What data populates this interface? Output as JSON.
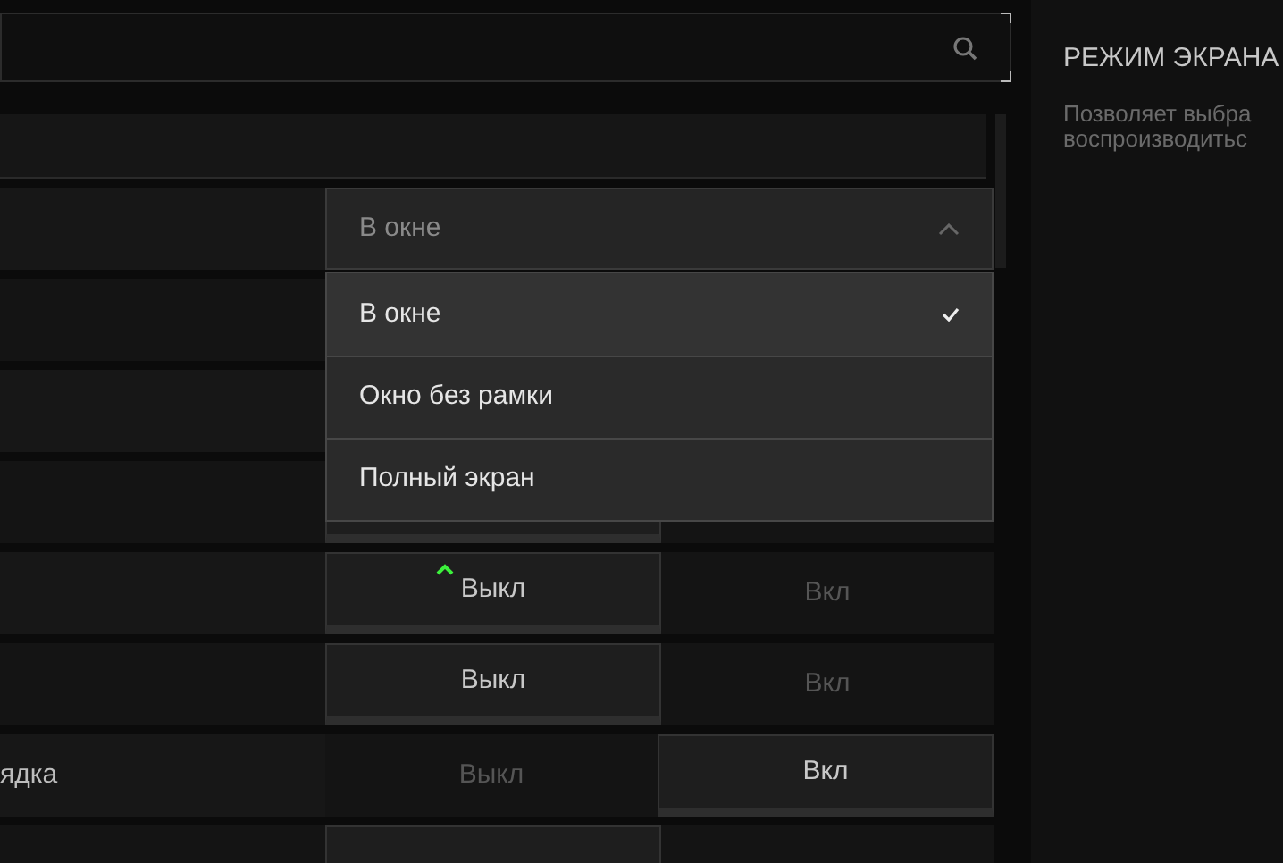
{
  "rows": [
    {
      "kind": "select",
      "value": "В окне",
      "expanded": true,
      "options": [
        {
          "label": "В окне",
          "selected": true
        },
        {
          "label": "Окно без рамки",
          "selected": false
        },
        {
          "label": "Полный экран",
          "selected": false
        }
      ]
    },
    {
      "kind": "hidden"
    },
    {
      "kind": "hidden"
    },
    {
      "kind": "toggle",
      "modified": false,
      "options": [
        {
          "selected": true
        },
        {
          "selected": false
        }
      ]
    },
    {
      "kind": "toggle",
      "modified": true,
      "options": [
        {
          "label": "Выкл",
          "selected": true
        },
        {
          "label": "Вкл",
          "selected": false
        }
      ]
    },
    {
      "kind": "toggle",
      "modified": false,
      "options": [
        {
          "label": "Выкл",
          "selected": true
        },
        {
          "label": "Вкл",
          "selected": false
        }
      ]
    },
    {
      "kind": "toggle",
      "label": "ядка",
      "modified": false,
      "options": [
        {
          "label": "Выкл",
          "selected": false
        },
        {
          "label": "Вкл",
          "selected": true
        }
      ]
    },
    {
      "kind": "toggle",
      "modified": false,
      "options": [
        {
          "selected": true
        },
        {
          "selected": false
        }
      ]
    }
  ],
  "info": {
    "title": "РЕЖИМ ЭКРАНА",
    "lines": [
      "Позволяет выбра",
      "воспроизводитьс"
    ]
  }
}
